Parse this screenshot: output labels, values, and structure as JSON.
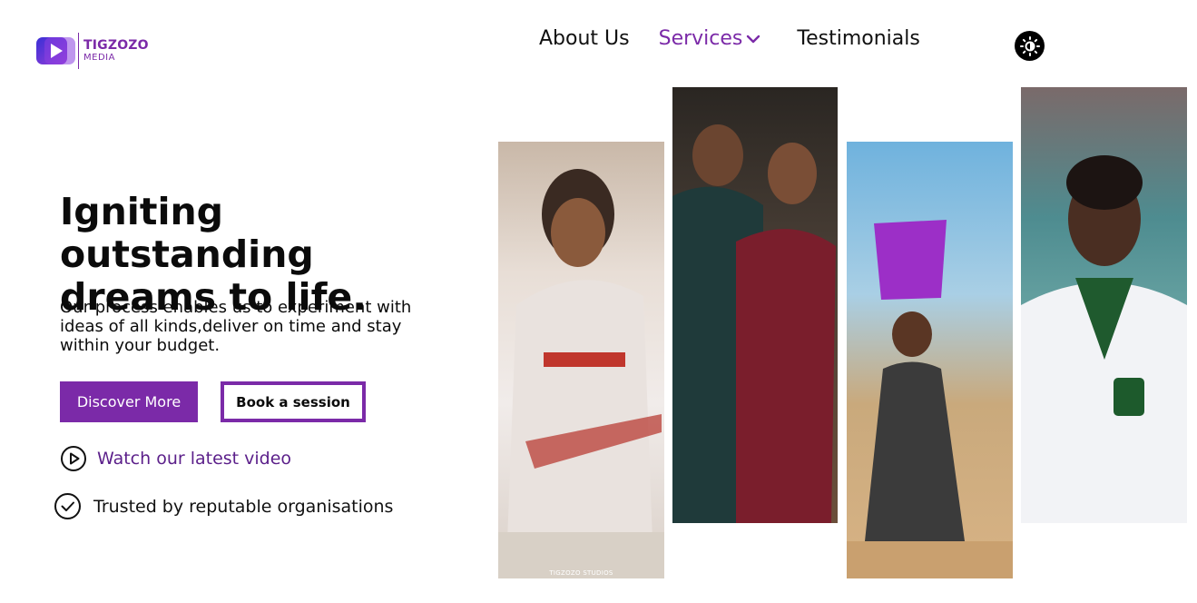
{
  "brand": {
    "name": "TIGZOZO",
    "sub": "MEDIA",
    "accent_color": "#7b2aa8"
  },
  "nav": {
    "items": [
      {
        "label": "About Us",
        "active": false
      },
      {
        "label": "Services",
        "active": true,
        "has_dropdown": true
      },
      {
        "label": "Testimonials",
        "active": false
      }
    ],
    "theme_toggle_icon": "sun-icon"
  },
  "hero": {
    "title": "Igniting outstanding dreams to life.",
    "description": "Our process enables us to experiment with ideas of all kinds,deliver on time and stay within your budget.",
    "primary_button": "Discover More",
    "secondary_button": "Book a session",
    "watch_link": "Watch our latest video",
    "trusted_text": "Trusted by reputable organisations"
  },
  "gallery": {
    "photos": [
      {
        "icon": "photo-woman-seated-dress",
        "watermark": "TIGZOZO STUDIOS"
      },
      {
        "icon": "photo-couple-portrait"
      },
      {
        "icon": "photo-child-carrying-bucket"
      },
      {
        "icon": "photo-student-uniform"
      }
    ]
  }
}
